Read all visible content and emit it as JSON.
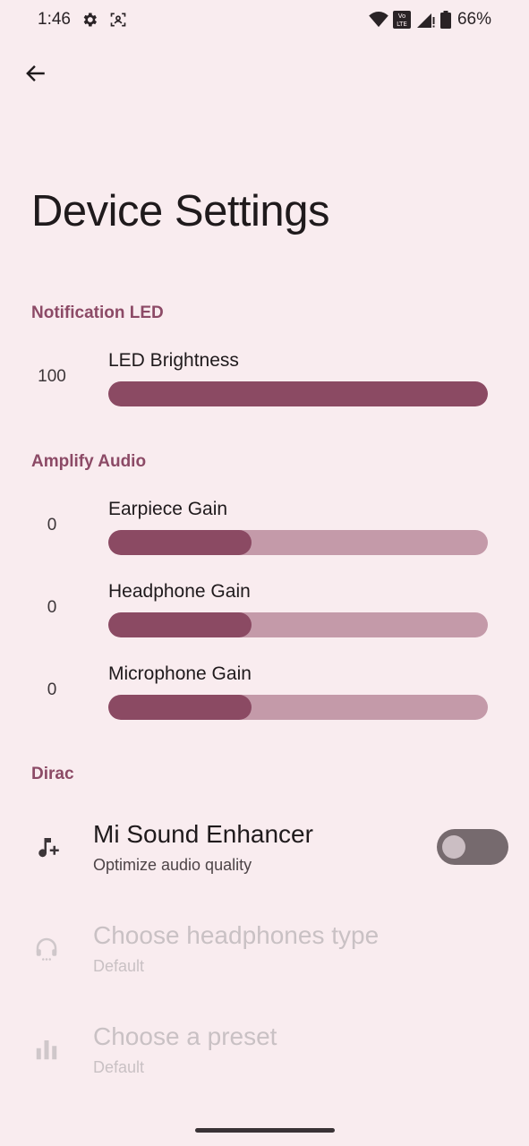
{
  "status_bar": {
    "time": "1:46",
    "battery_percent": "66%",
    "icons": [
      "gear-icon",
      "face-scan-icon",
      "wifi-icon",
      "volte-icon",
      "signal-icon",
      "battery-icon"
    ]
  },
  "header": {
    "back_icon": "arrow-back-icon",
    "title": "Device Settings"
  },
  "sections": {
    "notification_led": {
      "label": "Notification LED",
      "led_brightness": {
        "title": "LED Brightness",
        "value": "100",
        "fill_fraction": 1.0
      }
    },
    "amplify_audio": {
      "label": "Amplify Audio",
      "earpiece": {
        "title": "Earpiece Gain",
        "value": "0",
        "fill_fraction": 0.377
      },
      "headphone": {
        "title": "Headphone Gain",
        "value": "0",
        "fill_fraction": 0.377
      },
      "microphone": {
        "title": "Microphone Gain",
        "value": "0",
        "fill_fraction": 0.377
      }
    },
    "dirac": {
      "label": "Dirac",
      "enhancer": {
        "title": "Mi Sound Enhancer",
        "summary": "Optimize audio quality",
        "enabled": false,
        "icon": "music-note-plus-icon"
      },
      "headphones_type": {
        "title": "Choose headphones type",
        "summary": "Default",
        "icon": "headset-icon"
      },
      "preset": {
        "title": "Choose a preset",
        "summary": "Default",
        "icon": "equalizer-icon"
      }
    }
  },
  "colors": {
    "background": "#f9ecef",
    "accent": "#8b4a63",
    "track": "#c49aa9",
    "category": "#8c4a66"
  }
}
